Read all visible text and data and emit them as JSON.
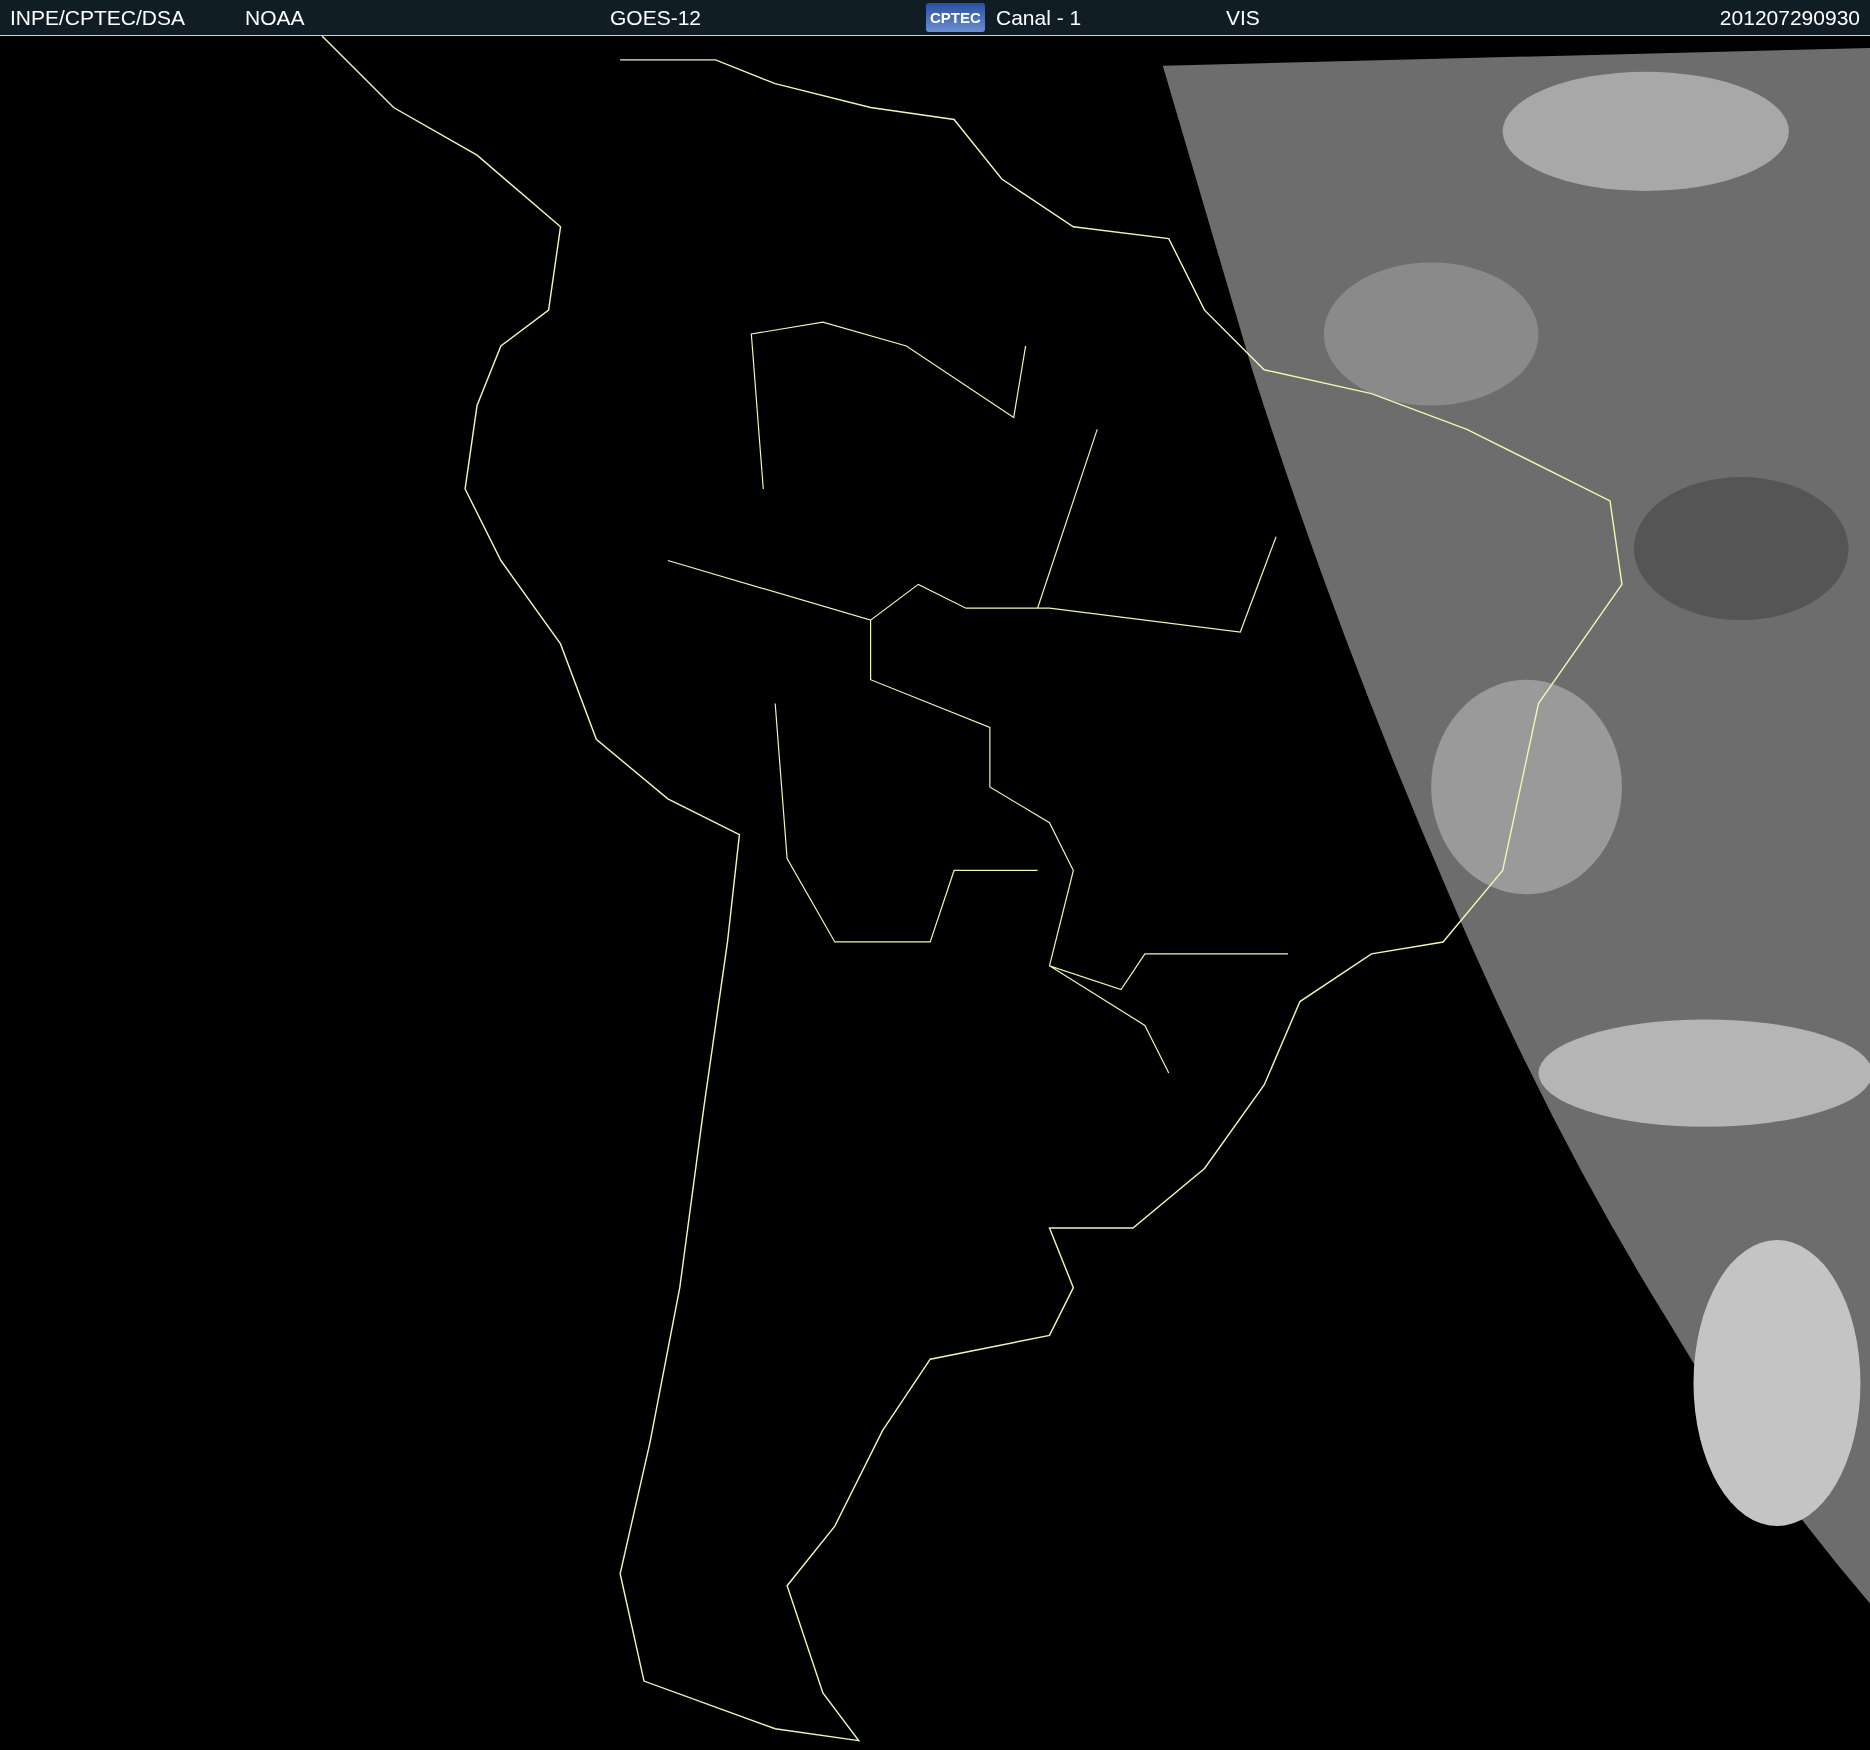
{
  "header": [
    {
      "kind": "text",
      "text": "INPE/CPTEC/DSA"
    },
    {
      "kind": "text",
      "text": "NOAA"
    },
    {
      "kind": "text",
      "text": "GOES-12"
    },
    {
      "kind": "logo",
      "text": "CPTEC"
    },
    {
      "kind": "text",
      "text": "Canal - 1"
    },
    {
      "kind": "text",
      "text": "VIS"
    },
    {
      "kind": "text",
      "text": "201207290930"
    }
  ]
}
